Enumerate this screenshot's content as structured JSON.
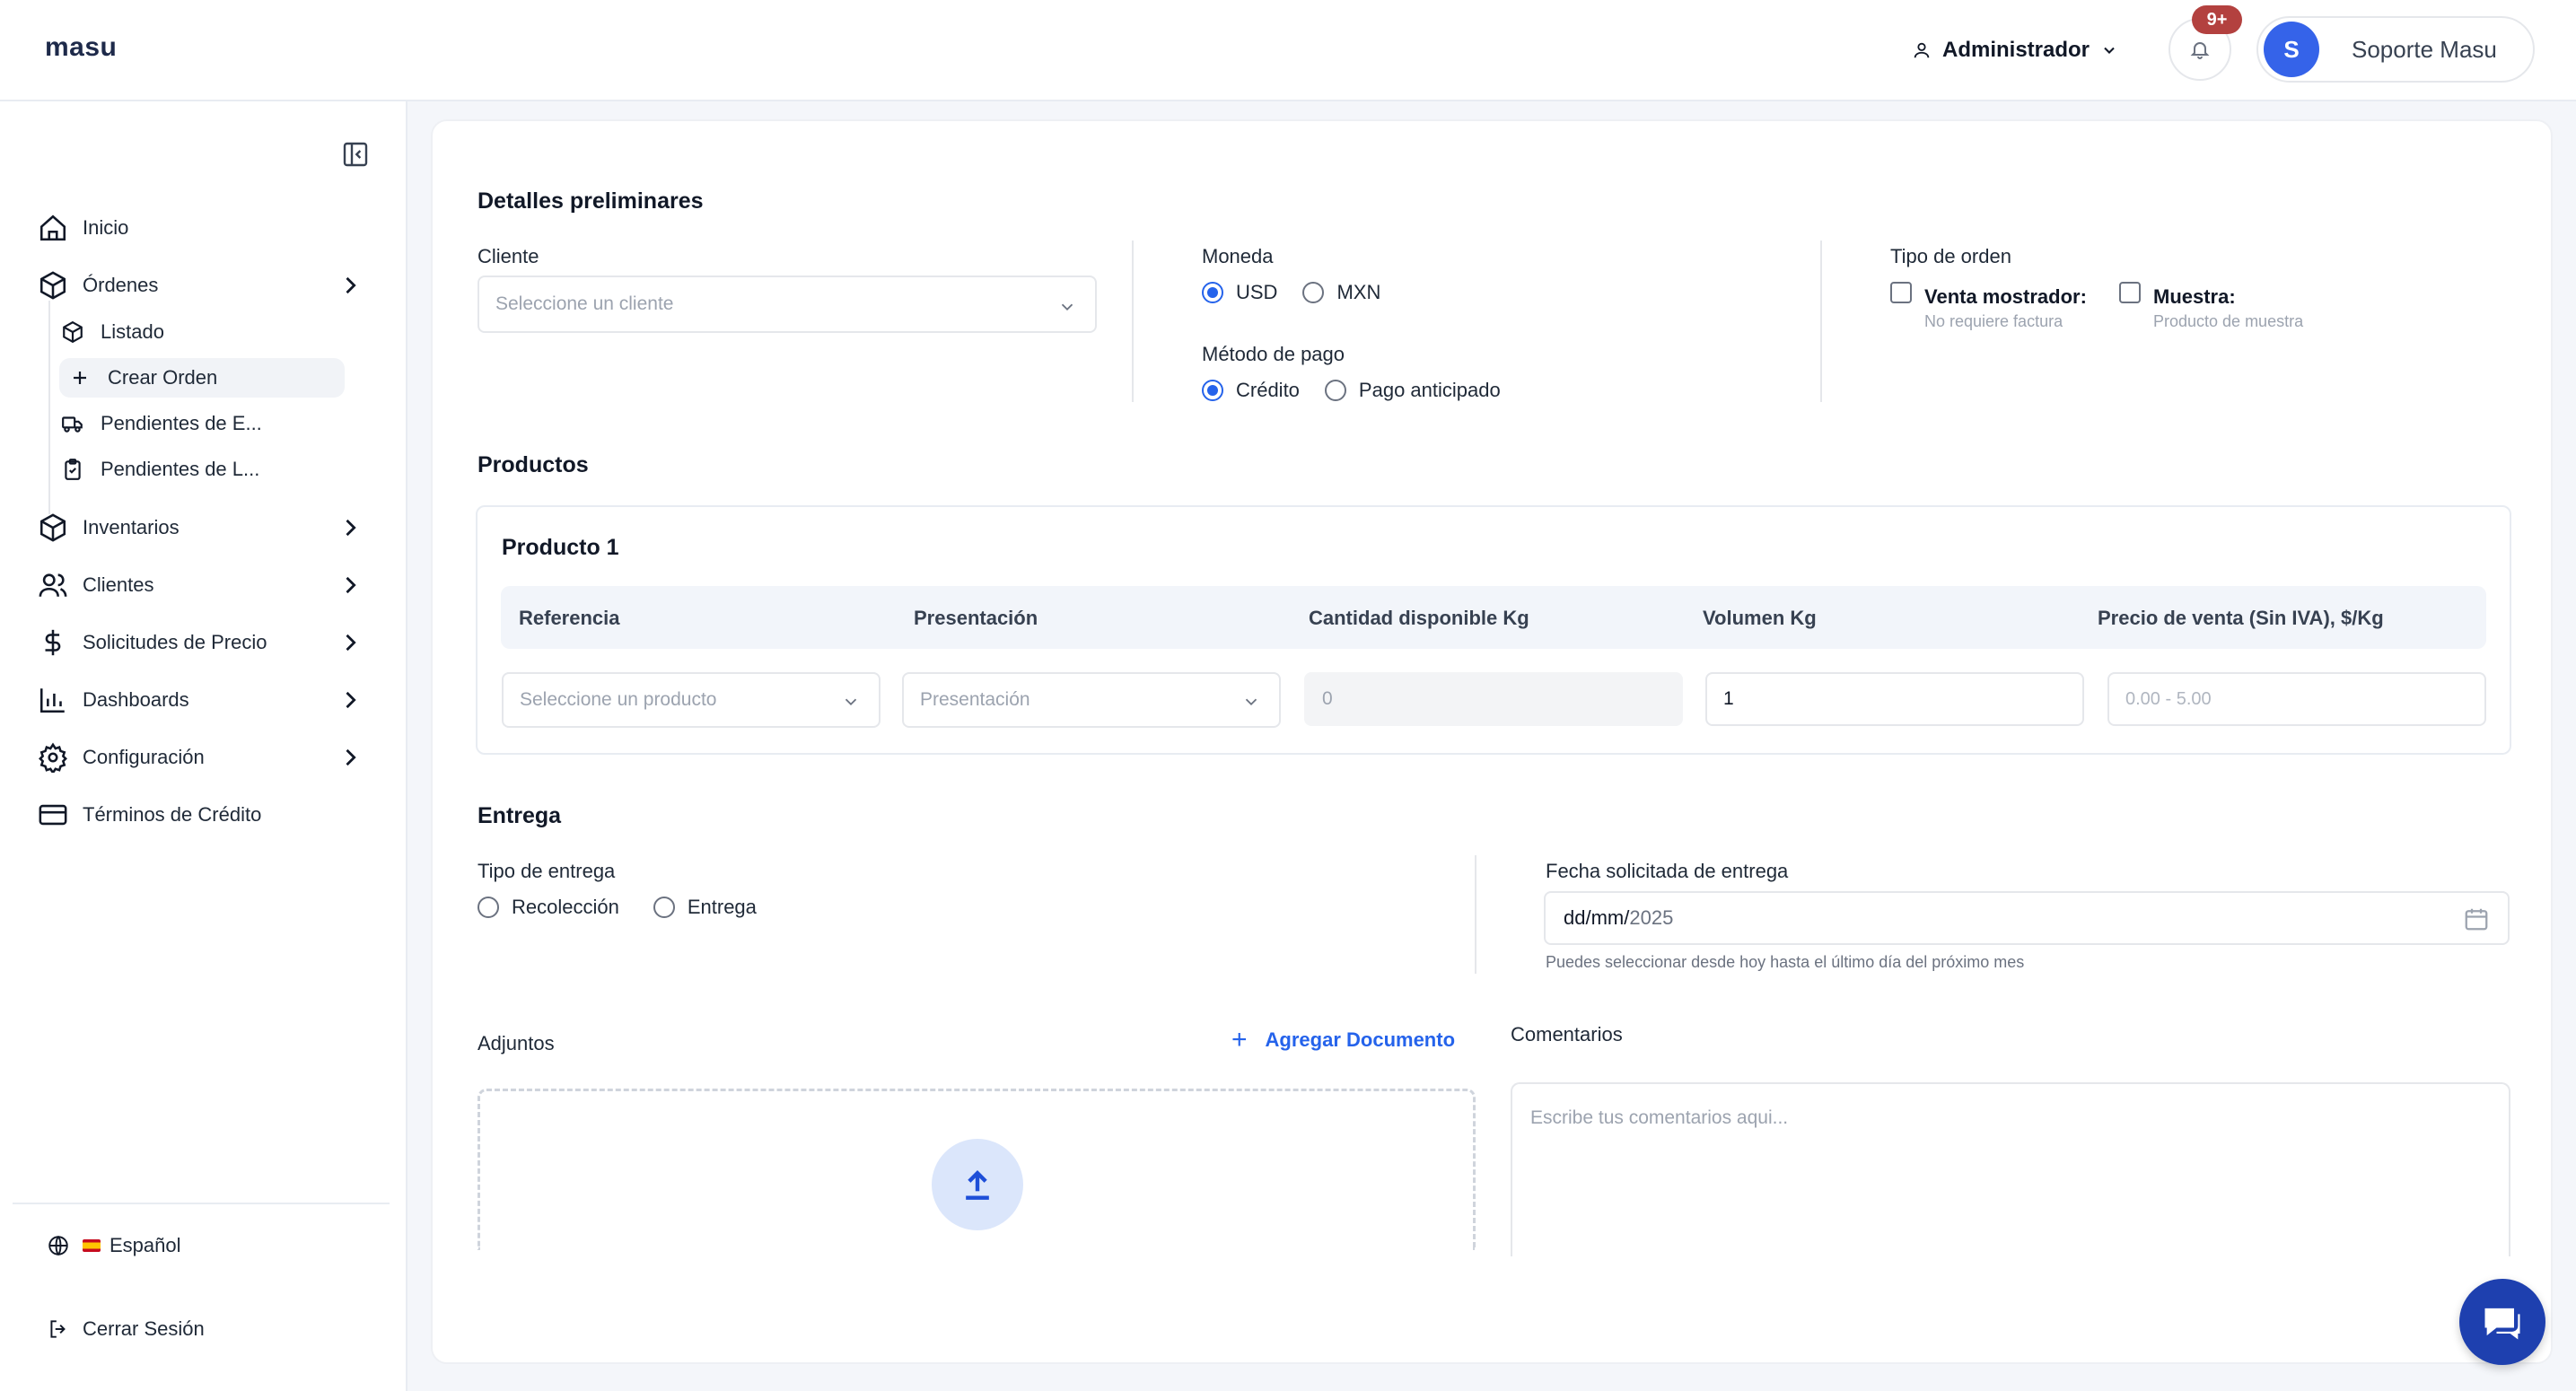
{
  "header": {
    "logo": "masu",
    "role": "Administrador",
    "notifications_badge": "9+",
    "user_initial": "S",
    "user_name": "Soporte Masu"
  },
  "sidebar": {
    "items": [
      {
        "label": "Inicio",
        "icon": "home-icon"
      },
      {
        "label": "Órdenes",
        "icon": "box-icon"
      },
      {
        "label": "Inventarios",
        "icon": "box-icon"
      },
      {
        "label": "Clientes",
        "icon": "users-icon"
      },
      {
        "label": "Solicitudes de Precio",
        "icon": "dollar-icon"
      },
      {
        "label": "Dashboards",
        "icon": "bar-chart-icon"
      },
      {
        "label": "Configuración",
        "icon": "gear-icon"
      },
      {
        "label": "Términos de Crédito",
        "icon": "credit-card-icon"
      }
    ],
    "orders_sub": [
      {
        "label": "Listado",
        "icon": "box-icon"
      },
      {
        "label": "Crear Orden",
        "icon": "plus-icon"
      },
      {
        "label": "Pendientes de E...",
        "icon": "truck-icon"
      },
      {
        "label": "Pendientes de L...",
        "icon": "clipboard-icon"
      }
    ],
    "language": "Español",
    "logout": "Cerrar Sesión"
  },
  "form": {
    "preliminary_title": "Detalles preliminares",
    "client_label": "Cliente",
    "client_placeholder": "Seleccione un cliente",
    "currency_label": "Moneda",
    "currency_options": [
      "USD",
      "MXN"
    ],
    "currency_selected": "USD",
    "payment_label": "Método de pago",
    "payment_options": [
      "Crédito",
      "Pago anticipado"
    ],
    "payment_selected": "Crédito",
    "order_type_label": "Tipo de orden",
    "order_types": [
      {
        "title": "Venta mostrador:",
        "subtitle": "No requiere factura"
      },
      {
        "title": "Muestra:",
        "subtitle": "Producto de muestra"
      }
    ],
    "products_title": "Productos",
    "product_card_title": "Producto 1",
    "columns": [
      "Referencia",
      "Presentación",
      "Cantidad disponible Kg",
      "Volumen Kg",
      "Precio de venta (Sin IVA), $/Kg"
    ],
    "product_placeholder": "Seleccione un producto",
    "presentation_placeholder": "Presentación",
    "available_qty": "0",
    "volume": "1",
    "price_placeholder": "0.00 - 5.00",
    "delivery_title": "Entrega",
    "delivery_type_label": "Tipo de entrega",
    "delivery_options": [
      "Recolección",
      "Entrega"
    ],
    "date_label": "Fecha solicitada de entrega",
    "date_prefix": "dd/mm/",
    "date_year": "2025",
    "date_help": "Puedes seleccionar desde hoy hasta el último día del próximo mes",
    "attachments_label": "Adjuntos",
    "add_document": "Agregar Documento",
    "comments_label": "Comentarios",
    "comments_placeholder": "Escribe tus comentarios aqui..."
  },
  "colors": {
    "accent": "#2563eb",
    "badge": "#b3413f",
    "chat": "#1e40af"
  }
}
